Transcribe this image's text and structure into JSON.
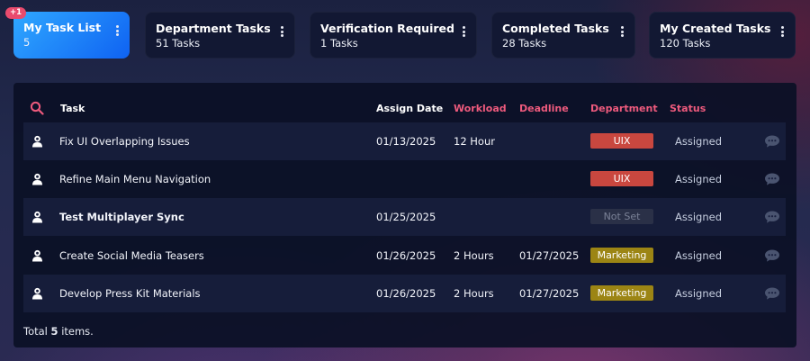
{
  "cards": [
    {
      "title": "My Task List",
      "count": "5",
      "badge": "+1",
      "active": true
    },
    {
      "title": "Department Tasks",
      "count": "51 Tasks"
    },
    {
      "title": "Verification Required",
      "count": "1 Tasks"
    },
    {
      "title": "Completed Tasks",
      "count": "28 Tasks"
    },
    {
      "title": "My Created Tasks",
      "count": "120 Tasks"
    }
  ],
  "table": {
    "headers": {
      "task": "Task",
      "assign_date": "Assign Date",
      "workload": "Workload",
      "deadline": "Deadline",
      "department": "Department",
      "status": "Status"
    },
    "rows": [
      {
        "task": "Fix UI Overlapping Issues",
        "assign_date": "01/13/2025",
        "workload": "12 Hour",
        "deadline": "",
        "department": "UIX",
        "status": "Assigned",
        "bold": false
      },
      {
        "task": "Refine Main Menu Navigation",
        "assign_date": "",
        "workload": "",
        "deadline": "",
        "department": "UIX",
        "status": "Assigned",
        "bold": false
      },
      {
        "task": "Test Multiplayer Sync",
        "assign_date": "01/25/2025",
        "workload": "",
        "deadline": "",
        "department": "Not Set",
        "status": "Assigned",
        "bold": true
      },
      {
        "task": "Create Social Media Teasers",
        "assign_date": "01/26/2025",
        "workload": "2 Hours",
        "deadline": "01/27/2025",
        "department": "Marketing",
        "status": "Assigned",
        "bold": false
      },
      {
        "task": "Develop Press Kit Materials",
        "assign_date": "01/26/2025",
        "workload": "2 Hours",
        "deadline": "01/27/2025",
        "department": "Marketing",
        "status": "Assigned",
        "bold": false
      }
    ]
  },
  "footer": {
    "prefix": "Total",
    "count": "5",
    "suffix": "items."
  },
  "department_colors": {
    "UIX": {
      "bg": "#c9473f",
      "fg": "#ffffff"
    },
    "Marketing": {
      "bg": "#9c8514",
      "fg": "#ffffff"
    },
    "Not Set": {
      "bg": "#2a3047",
      "fg": "#7b8297"
    }
  },
  "icons": {
    "search": "search-icon",
    "menu": "kebab-menu-icon",
    "row": "user-icon",
    "comment": "chat-bubble-icon"
  },
  "colors": {
    "accent_pink": "#ee5a7d",
    "active_card_start": "#2fa8ff",
    "active_card_end": "#0f62f2",
    "badge": "#e94b6e"
  }
}
